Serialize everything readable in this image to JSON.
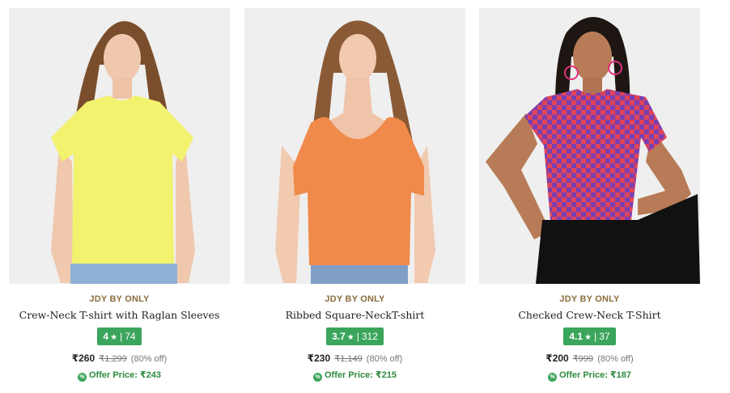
{
  "products": [
    {
      "brand": "JDY BY ONLY",
      "name": "Crew-Neck T-shirt with Raglan Sleeves",
      "rating": "4",
      "rating_count": "74",
      "price": "₹260",
      "mrp": "₹1,299",
      "discount": "(80% off)",
      "offer_label": "Offer Price: ₹243",
      "tshirt_color": "#f2f26e",
      "image_alt": "Yellow crew-neck t-shirt"
    },
    {
      "brand": "JDY BY ONLY",
      "name": "Ribbed Square-NeckT-shirt",
      "rating": "3.7",
      "rating_count": "312",
      "price": "₹230",
      "mrp": "₹1,149",
      "discount": "(80% off)",
      "offer_label": "Offer Price: ₹215",
      "tshirt_color": "#f08a4b",
      "image_alt": "Orange ribbed square-neck t-shirt"
    },
    {
      "brand": "JDY BY ONLY",
      "name": "Checked Crew-Neck T-Shirt",
      "rating": "4.1",
      "rating_count": "37",
      "price": "₹200",
      "mrp": "₹999",
      "discount": "(80% off)",
      "offer_label": "Offer Price: ₹187",
      "tshirt_color": "#7a3fb0",
      "image_alt": "Purple checked crew-neck t-shirt"
    }
  ],
  "icons": {
    "star": "star-icon",
    "offer": "offer-percent-icon"
  },
  "colors": {
    "brand_text": "#8a6d3b",
    "rating_badge": "#3ba55c",
    "offer_text": "#2e8b3e"
  }
}
